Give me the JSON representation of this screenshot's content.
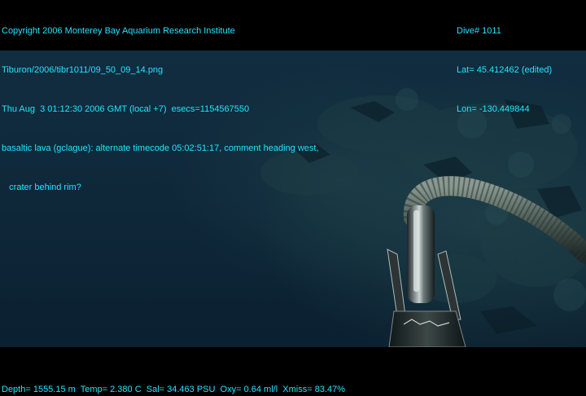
{
  "overlay": {
    "top_left": [
      "Copyright 2006 Monterey Bay Aquarium Research Institute",
      "Tiburon/2006/tibr1011/09_50_09_14.png",
      "Thu Aug  3 01:12:30 2006 GMT (local +7)  esecs=1154567550",
      "basaltic lava (gclague): alternate timecode 05:02:51:17, comment heading west,",
      "   crater behind rim?"
    ],
    "top_right": [
      "Dive# 1011",
      "Lat= 45.412462 (edited)",
      "Lon= -130.449844"
    ],
    "bottom": "Depth= 1555.15 m  Temp= 2.380 C  Sal= 34.463 PSU  Oxy= 0.64 ml/l  Xmiss= 83.47%"
  },
  "colors": {
    "overlay_text": "#22e4ff",
    "water": "#0f2a3c",
    "background": "#000000"
  }
}
